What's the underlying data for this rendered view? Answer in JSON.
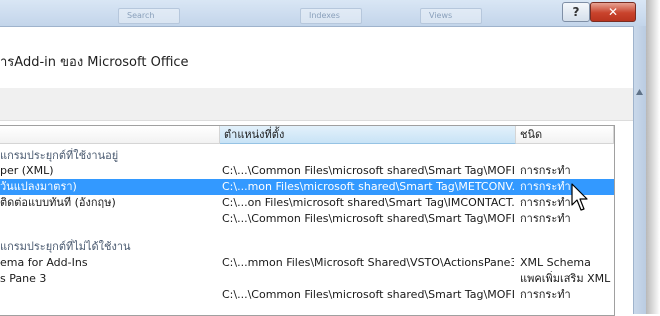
{
  "window": {
    "tabs": [
      "Search",
      "Indexes",
      "Views"
    ],
    "help_label": "?",
    "close_label": "✕"
  },
  "header": {
    "title": "ารAdd-in ของ Microsoft Office"
  },
  "table": {
    "columns": [
      "ตำแหน่งที่ตั้ง",
      "ชนิด"
    ],
    "rows": [
      {
        "kind": "group",
        "name": "แกรมประยุกต์ที่ใช้งานอยู่",
        "location": "",
        "type": ""
      },
      {
        "kind": "item",
        "name": "per (XML)",
        "location": "C:\\...\\Common Files\\microsoft shared\\Smart Tag\\MOFL.DLL",
        "type": "การกระทำ"
      },
      {
        "kind": "item",
        "selected": true,
        "name": "วันแปลงมาตรา)",
        "location": "C:\\...mon Files\\microsoft shared\\Smart Tag\\METCONV.DLL",
        "type": "การกระทำ"
      },
      {
        "kind": "item",
        "name": "ติดต่อแบบทันที (อังกฤษ)",
        "location": "C:\\...on Files\\microsoft shared\\Smart Tag\\IMCONTACT.DLL",
        "type": "การกระทำ"
      },
      {
        "kind": "item",
        "name": "",
        "location": "C:\\...\\Common Files\\microsoft shared\\Smart Tag\\MOFL.DLL",
        "type": "การกระทำ"
      },
      {
        "kind": "spacer",
        "name": "",
        "location": "",
        "type": ""
      },
      {
        "kind": "group",
        "name": "แกรมประยุกต์ที่ไม่ได้ใช้งาน",
        "location": "",
        "type": ""
      },
      {
        "kind": "item",
        "name": "ema for Add-Ins",
        "location": "C:\\...mmon Files\\Microsoft Shared\\VSTO\\ActionsPane3.xsd",
        "type": "XML Schema"
      },
      {
        "kind": "item",
        "name": "s Pane 3",
        "location": "",
        "type": "แพคเพิ่มเสริม XML"
      },
      {
        "kind": "item",
        "name": "",
        "location": "C:\\...\\Common Files\\microsoft shared\\Smart Tag\\MOFL.DLL",
        "type": "การกระทำ"
      }
    ]
  }
}
